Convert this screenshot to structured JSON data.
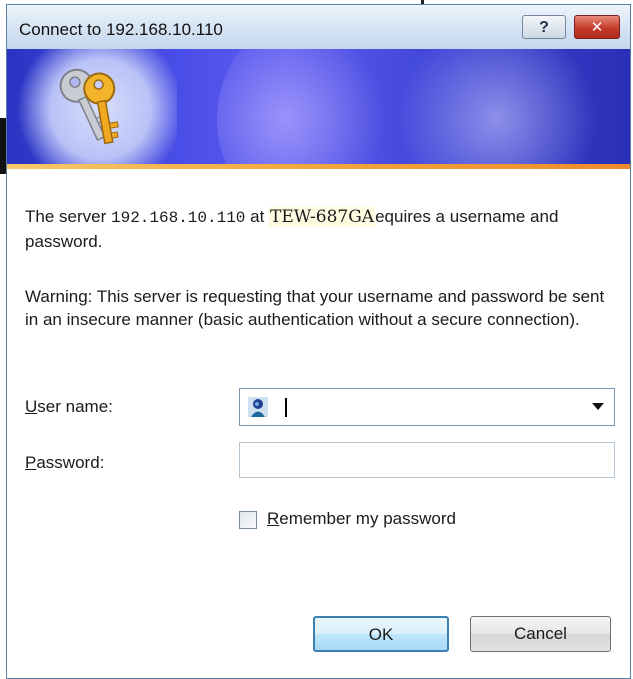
{
  "window": {
    "title": "Connect to 192.168.10.110",
    "help_label": "?",
    "close_label": "✕"
  },
  "banner": {
    "icon": "keys-icon"
  },
  "message": {
    "prefix": "The server ",
    "server": "192.168.10.110",
    "at": " at ",
    "realm": "TEW-687GA",
    "suffix": "equires a username and password."
  },
  "warning": "Warning: This server is requesting that your username and password be sent in an insecure manner (basic authentication without a secure connection).",
  "form": {
    "username_label_access": "U",
    "username_label_rest": "ser name:",
    "username_value": "",
    "username_icon": "user-account-icon",
    "password_label_access": "P",
    "password_label_rest": "assword:",
    "password_value": "",
    "remember_access": "R",
    "remember_rest": "emember my password",
    "remember_checked": false
  },
  "buttons": {
    "ok": "OK",
    "cancel": "Cancel"
  },
  "colors": {
    "banner": "#3e45d7",
    "title_bar": "#d4e3f3",
    "close_button": "#c43b2b",
    "default_button_border": "#3c7fb1"
  }
}
